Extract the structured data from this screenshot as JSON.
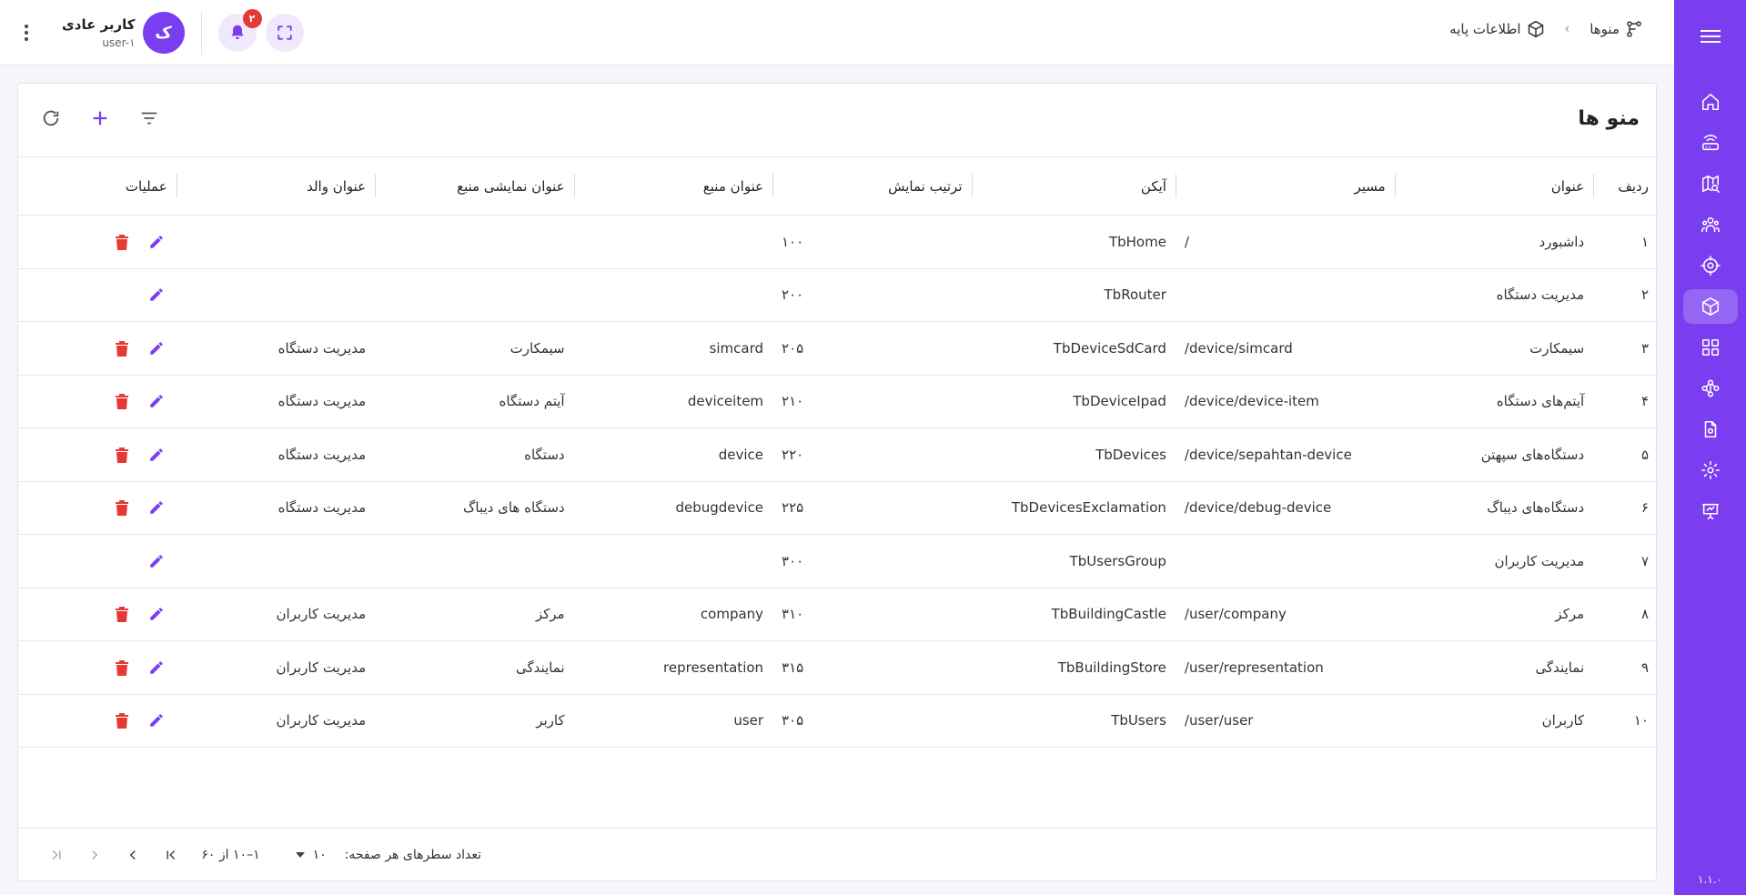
{
  "sidebar": {
    "version": "۱.۱.۰",
    "items": [
      {
        "icon": "home-icon"
      },
      {
        "icon": "router-icon"
      },
      {
        "icon": "map-search-icon"
      },
      {
        "icon": "users-group-icon"
      },
      {
        "icon": "crosshair-icon"
      },
      {
        "icon": "cube-icon",
        "active": true
      },
      {
        "icon": "grid-icon"
      },
      {
        "icon": "network-icon"
      },
      {
        "icon": "file-settings-icon"
      },
      {
        "icon": "gear-icon"
      },
      {
        "icon": "presentation-icon"
      }
    ]
  },
  "header": {
    "breadcrumb": [
      {
        "label": "اطلاعات پایه",
        "icon": "cube-icon"
      },
      {
        "label": "منوها",
        "icon": "hierarchy-icon"
      }
    ],
    "user": {
      "name": "کاربر عادی",
      "id": "user-۱",
      "avatar_letter": "ک"
    },
    "notifications_count": "۲"
  },
  "page": {
    "title": "منو ها"
  },
  "table": {
    "columns": [
      "ردیف",
      "عنوان",
      "مسیر",
      "آیکن",
      "ترتیب نمایش",
      "عنوان منبع",
      "عنوان نمایشی منبع",
      "عنوان والد",
      "عملیات"
    ],
    "rows": [
      {
        "n": "۱",
        "title": "داشبورد",
        "path": "/",
        "icon": "TbHome",
        "order": "۱۰۰",
        "source": "",
        "source_display": "",
        "parent": "",
        "can_delete": true
      },
      {
        "n": "۲",
        "title": "مدیریت دستگاه",
        "path": "",
        "icon": "TbRouter",
        "order": "۲۰۰",
        "source": "",
        "source_display": "",
        "parent": "",
        "can_delete": false
      },
      {
        "n": "۳",
        "title": "سیمکارت",
        "path": "/device/simcard",
        "icon": "TbDeviceSdCard",
        "order": "۲۰۵",
        "source": "simcard",
        "source_display": "سیمکارت",
        "parent": "مدیریت دستگاه",
        "can_delete": true
      },
      {
        "n": "۴",
        "title": "آیتم‌های دستگاه",
        "path": "/device/device-item",
        "icon": "TbDeviceIpad",
        "order": "۲۱۰",
        "source": "deviceitem",
        "source_display": "آیتم دستگاه",
        "parent": "مدیریت دستگاه",
        "can_delete": true
      },
      {
        "n": "۵",
        "title": "دستگاه‌های سپهتن",
        "path": "/device/sepahtan-device",
        "icon": "TbDevices",
        "order": "۲۲۰",
        "source": "device",
        "source_display": "دستگاه",
        "parent": "مدیریت دستگاه",
        "can_delete": true
      },
      {
        "n": "۶",
        "title": "دستگاه‌های دیباگ",
        "path": "/device/debug-device",
        "icon": "TbDevicesExclamation",
        "order": "۲۲۵",
        "source": "debugdevice",
        "source_display": "دستگاه های دیباگ",
        "parent": "مدیریت دستگاه",
        "can_delete": true
      },
      {
        "n": "۷",
        "title": "مدیریت کاربران",
        "path": "",
        "icon": "TbUsersGroup",
        "order": "۳۰۰",
        "source": "",
        "source_display": "",
        "parent": "",
        "can_delete": false
      },
      {
        "n": "۸",
        "title": "مرکز",
        "path": "/user/company",
        "icon": "TbBuildingCastle",
        "order": "۳۱۰",
        "source": "company",
        "source_display": "مرکز",
        "parent": "مدیریت کاربران",
        "can_delete": true
      },
      {
        "n": "۹",
        "title": "نمایندگی",
        "path": "/user/representation",
        "icon": "TbBuildingStore",
        "order": "۳۱۵",
        "source": "representation",
        "source_display": "نمایندگی",
        "parent": "مدیریت کاربران",
        "can_delete": true
      },
      {
        "n": "۱۰",
        "title": "کاربران",
        "path": "/user/user",
        "icon": "TbUsers",
        "order": "۳۰۵",
        "source": "user",
        "source_display": "کاربر",
        "parent": "مدیریت کاربران",
        "can_delete": true
      }
    ]
  },
  "pagination": {
    "rows_per_page_label": "تعداد سطرهای هر صفحه:",
    "rows_per_page": "۱۰",
    "range": "۱–۱۰ از ۶۰"
  },
  "colors": {
    "accent": "#7a3df0",
    "delete": "#e53935",
    "sidebar_active": "#9565f4"
  }
}
